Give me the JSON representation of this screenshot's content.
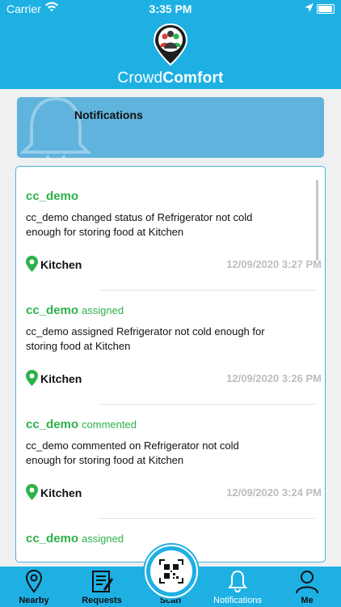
{
  "status": {
    "carrier": "Carrier",
    "time": "3:35 PM"
  },
  "brand": {
    "prefix": "Crowd",
    "bold": "Comfort"
  },
  "banner": {
    "title": "Notifications"
  },
  "notifications": [
    {
      "user": "cc_demo",
      "action": "",
      "message": "cc_demo changed status of Refrigerator not cold enough for storing food at Kitchen",
      "location": "Kitchen",
      "date": "12/09/2020 3:27 PM"
    },
    {
      "user": "cc_demo",
      "action": "assigned",
      "message": "cc_demo assigned Refrigerator not cold enough for storing food at Kitchen",
      "location": "Kitchen",
      "date": "12/09/2020 3:26 PM"
    },
    {
      "user": "cc_demo",
      "action": "commented",
      "message": "cc_demo commented on Refrigerator not cold enough for storing food at Kitchen",
      "location": "Kitchen",
      "date": "12/09/2020 3:24 PM"
    },
    {
      "user": "cc_demo",
      "action": "assigned",
      "message": "",
      "location": "",
      "date": ""
    }
  ],
  "tabs": {
    "nearby": "Nearby",
    "requests": "Requests",
    "scan": "Scan",
    "notifications": "Notifications",
    "me": "Me"
  },
  "colors": {
    "primary": "#1eb0e3",
    "banner": "#5fb3dd",
    "accent_green": "#2db24a"
  }
}
